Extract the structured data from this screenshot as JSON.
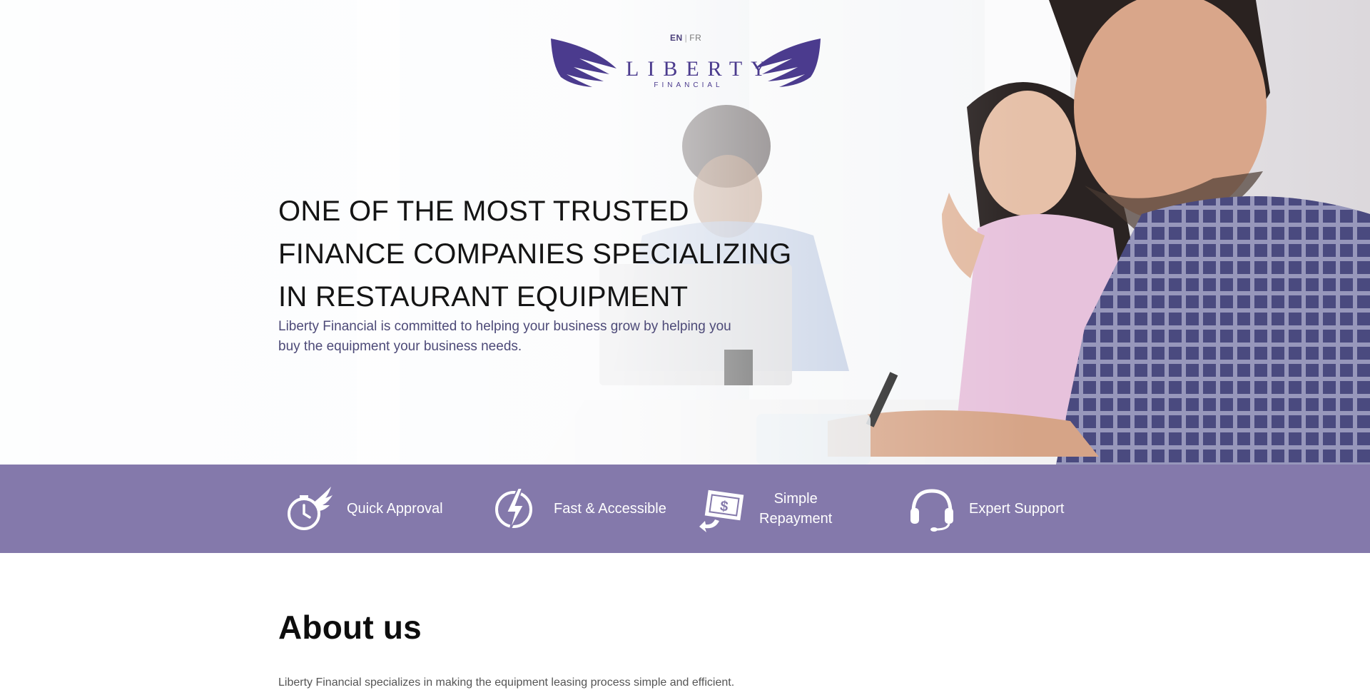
{
  "header": {
    "lang_active": "EN",
    "lang_separator": "|",
    "lang_other": "FR",
    "logo_word": "LIBERTY",
    "logo_subword": "FINANCIAL"
  },
  "hero": {
    "headline_line1": "ONE OF THE MOST TRUSTED",
    "headline_line2": "FINANCE COMPANIES SPECIALIZING",
    "headline_line3": "IN RESTAURANT EQUIPMENT",
    "subhead_line1": "Liberty Financial is committed to helping your business grow by helping you",
    "subhead_line2": "buy the equipment your business needs."
  },
  "features": [
    {
      "icon": "winged-clock-icon",
      "label": "Quick Approval"
    },
    {
      "icon": "lightning-bolt-icon",
      "label": "Fast & Accessible"
    },
    {
      "icon": "money-return-icon",
      "label_line1": "Simple",
      "label_line2": "Repayment"
    },
    {
      "icon": "headset-icon",
      "label": "Expert Support"
    }
  ],
  "about": {
    "title": "About us",
    "text_line1": "Liberty Financial specializes in making the equipment leasing process simple and efficient."
  },
  "colors": {
    "brand_purple": "#4b3b8e",
    "feature_bar": "#8479ab",
    "subhead": "#4d4a78"
  }
}
